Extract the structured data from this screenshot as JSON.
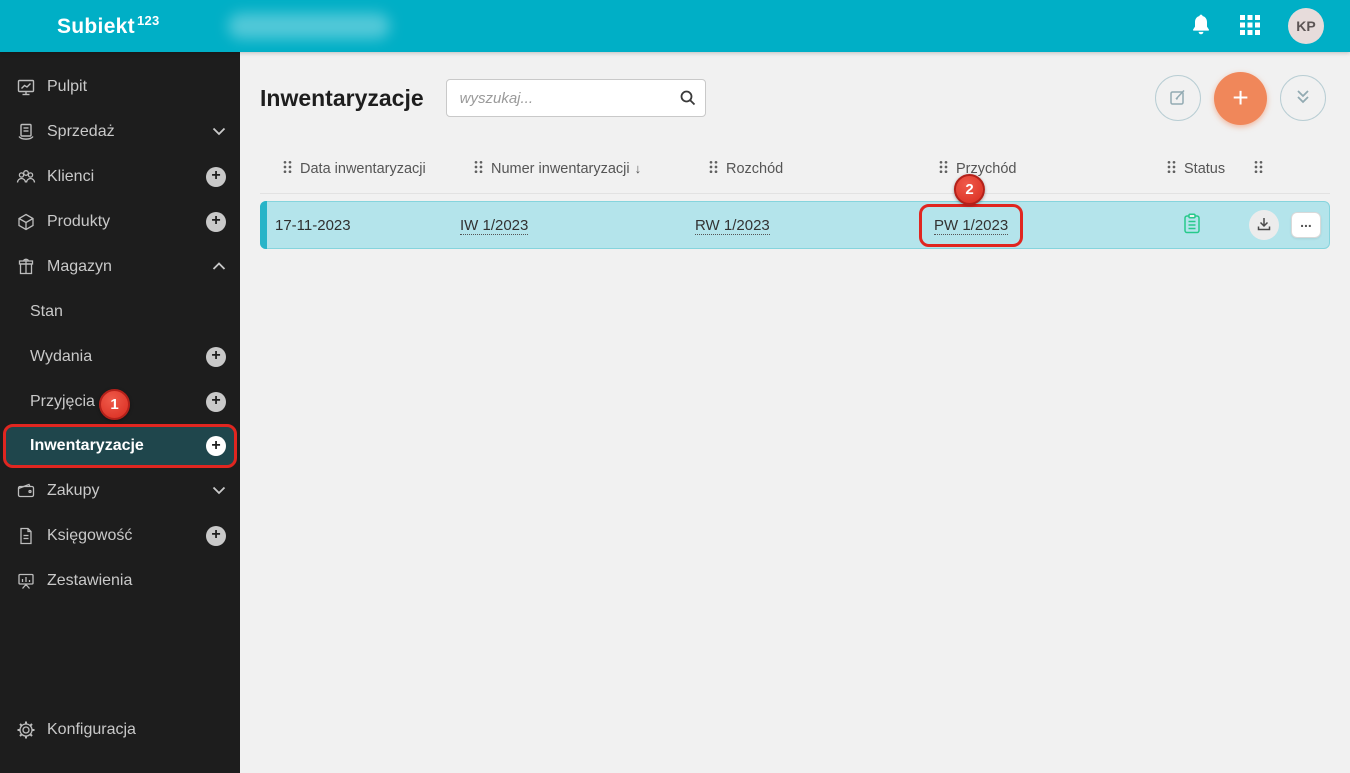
{
  "topbar": {
    "brand": "Subiekt",
    "brand_sup": "123",
    "avatar_initials": "KP"
  },
  "sidebar": {
    "items": [
      {
        "label": "Pulpit"
      },
      {
        "label": "Sprzedaż"
      },
      {
        "label": "Klienci"
      },
      {
        "label": "Produkty"
      },
      {
        "label": "Magazyn"
      },
      {
        "label": "Stan"
      },
      {
        "label": "Wydania"
      },
      {
        "label": "Przyjęcia"
      },
      {
        "label": "Inwentaryzacje"
      },
      {
        "label": "Zakupy"
      },
      {
        "label": "Księgowość"
      },
      {
        "label": "Zestawienia"
      },
      {
        "label": "Konfiguracja"
      }
    ]
  },
  "page": {
    "title": "Inwentaryzacje",
    "search_placeholder": "wyszukaj..."
  },
  "table": {
    "headers": {
      "date": "Data inwentaryzacji",
      "number": "Numer inwentaryzacji",
      "outflow": "Rozchód",
      "inflow": "Przychód",
      "status": "Status"
    },
    "rows": [
      {
        "date": "17-11-2023",
        "number": "IW 1/2023",
        "outflow": "RW 1/2023",
        "inflow": "PW 1/2023"
      }
    ]
  },
  "annotations": {
    "step1": "1",
    "step2": "2"
  },
  "icons": {
    "plus": "+",
    "more": "...",
    "sort_desc": "↓"
  },
  "colors": {
    "topbar_teal": "#00afc6",
    "sidebar_dark": "#1d1d1d",
    "selected_item_bg": "#1f464c",
    "row_highlight": "#b4e4eb",
    "row_accent": "#28b4c8",
    "primary_orange": "#f0875a",
    "annotation_red": "#e02620",
    "status_green": "#26c98b"
  }
}
